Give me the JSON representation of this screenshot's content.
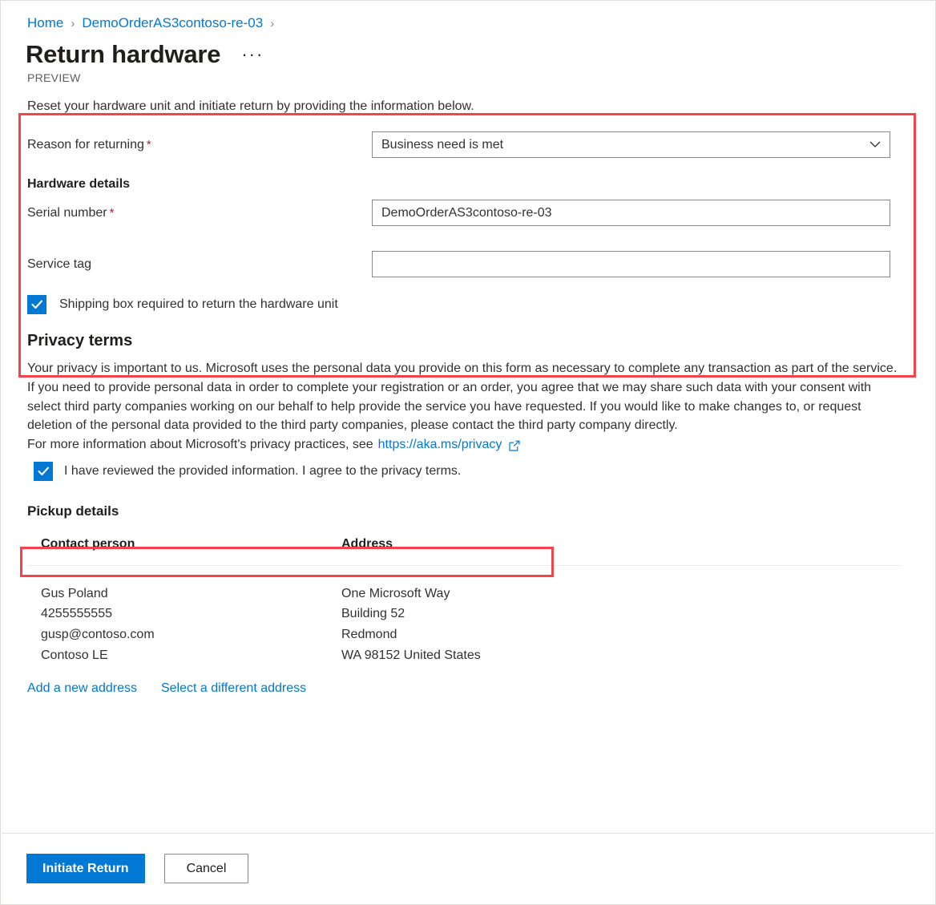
{
  "breadcrumb": {
    "items": [
      {
        "label": "Home"
      },
      {
        "label": "DemoOrderAS3contoso-re-03"
      }
    ],
    "separator": "›"
  },
  "header": {
    "title": "Return hardware",
    "more_label": "···",
    "preview_label": "PREVIEW"
  },
  "form": {
    "intro": "Reset your hardware unit and initiate return by providing the information below.",
    "reason": {
      "label": "Reason for returning",
      "required_marker": "*",
      "value": "Business need is met"
    },
    "hardware_details_heading": "Hardware details",
    "serial_number": {
      "label": "Serial number",
      "required_marker": "*",
      "value": "DemoOrderAS3contoso-re-03",
      "placeholder": ""
    },
    "service_tag": {
      "label": "Service tag",
      "value": "",
      "placeholder": ""
    },
    "shipping_box": {
      "label": "Shipping box required to return the hardware unit",
      "checked": "true"
    }
  },
  "privacy": {
    "heading": "Privacy terms",
    "body": "Your privacy is important to us. Microsoft uses the personal data you provide on this form as necessary to complete any transaction as part of the service. If you need to provide personal data in order to complete your registration or an order, you agree that we may share such data with your consent with select third party companies working on our behalf to help provide the service you have requested. If you would like to make changes to, or request deletion of the personal data provided to the third party companies, please contact the third party company directly.",
    "link_prefix": "For more information about Microsoft's privacy practices, see",
    "link_text": "https://aka.ms/privacy",
    "agree": {
      "label": "I have reviewed the provided information. I agree to the privacy terms.",
      "checked": "true"
    }
  },
  "pickup": {
    "heading": "Pickup details",
    "columns": {
      "contact": "Contact person",
      "address": "Address"
    },
    "contact": {
      "name": "Gus Poland",
      "phone": "4255555555",
      "email": "gusp@contoso.com",
      "company": "Contoso LE"
    },
    "address": {
      "line1": "One Microsoft Way",
      "line2": "Building 52",
      "city": "Redmond",
      "region": "WA 98152 United States"
    },
    "links": {
      "add": "Add a new address",
      "select": "Select a different address"
    }
  },
  "footer": {
    "primary": "Initiate Return",
    "secondary": "Cancel"
  },
  "colors": {
    "accent": "#0078d4",
    "required": "#a4262c",
    "annotation": "#f4444b"
  }
}
